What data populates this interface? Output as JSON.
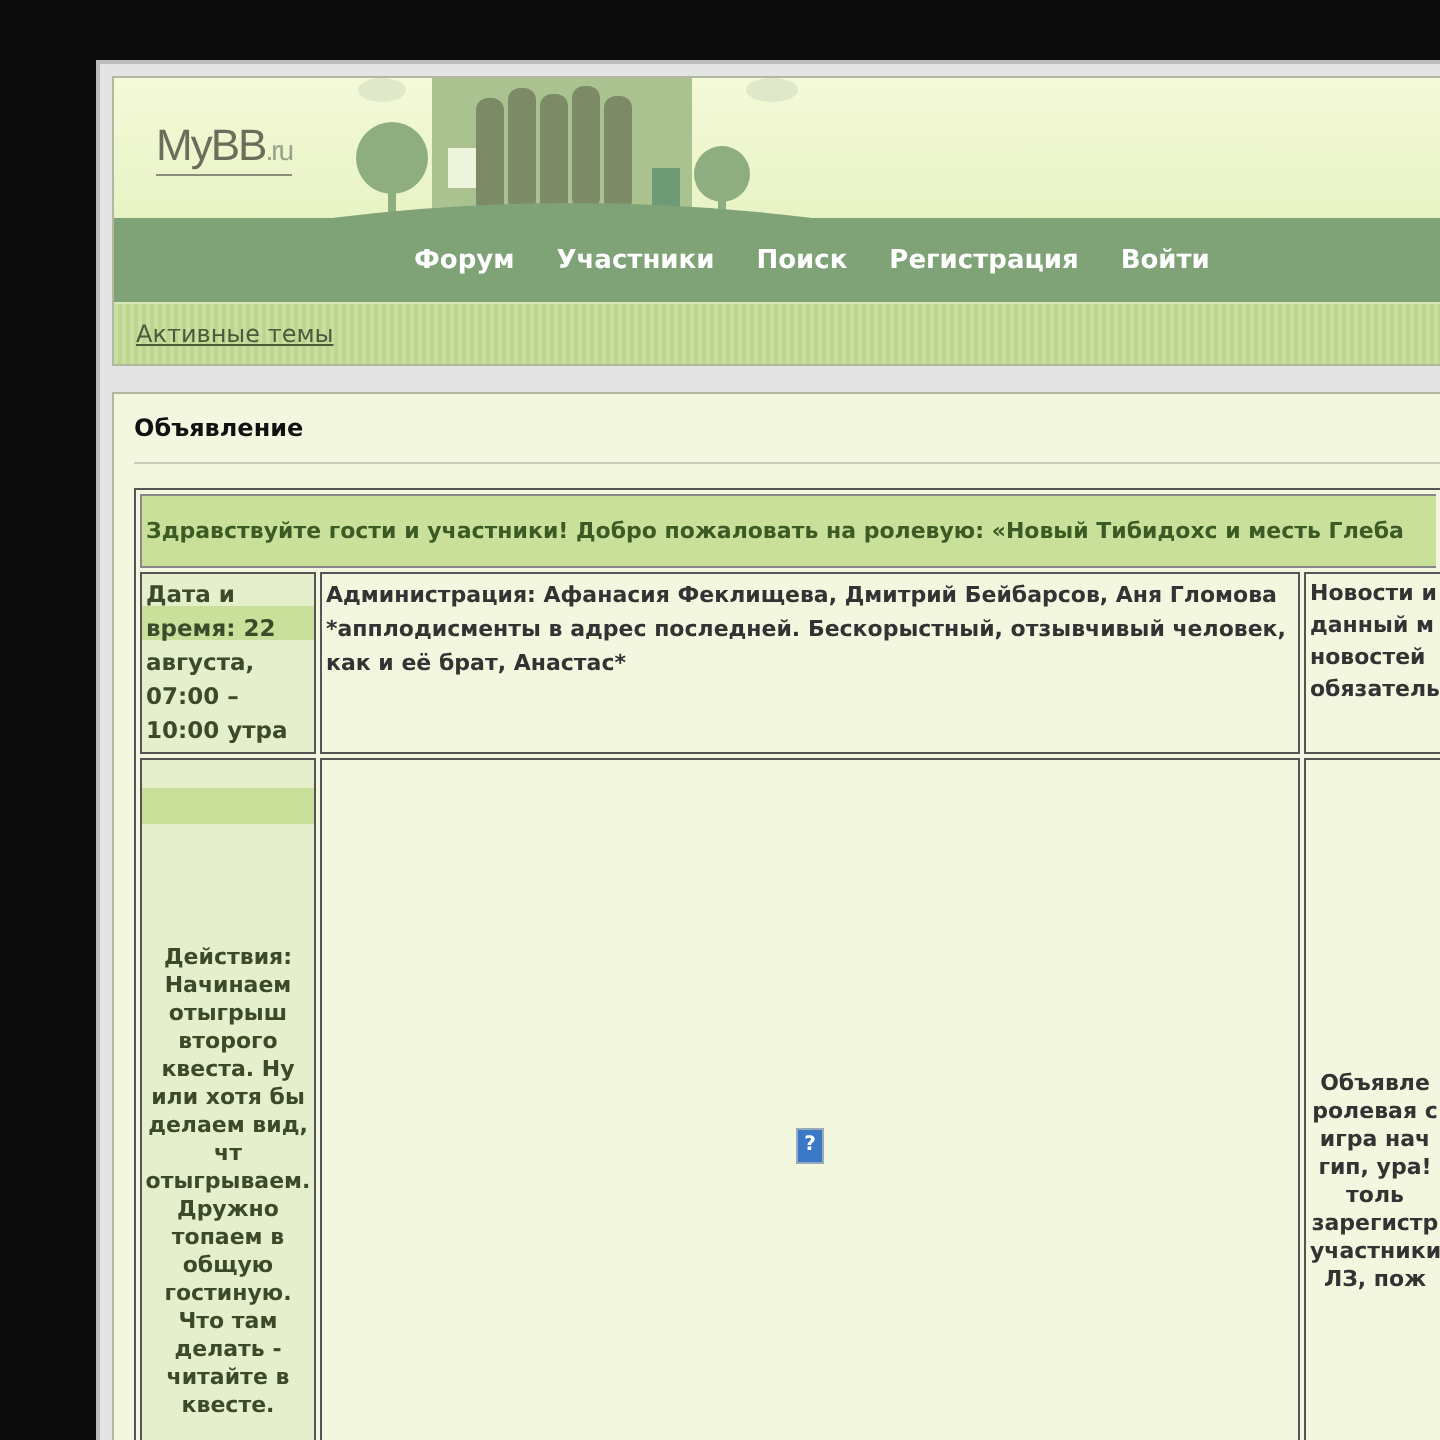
{
  "logo": {
    "main": "MyBB",
    "suffix": ".ru"
  },
  "nav": [
    {
      "label": "Форум"
    },
    {
      "label": "Участники"
    },
    {
      "label": "Поиск"
    },
    {
      "label": "Регистрация"
    },
    {
      "label": "Войти"
    }
  ],
  "subnav": {
    "link": "Активные темы"
  },
  "announcement": {
    "title": "Объявление",
    "banner": "Здравствуйте гости и участники! Добро пожаловать на ролевую: «Новый Тибидохс и месть Глеба",
    "date": "Дата и\nвремя: 22\nавгуста,\n07:00 –\n10:00 утра",
    "admins": "Администрация: Афанасия Феклищева, Дмитрий Бейбарсов, Аня Гломова *апплодисменты в адрес последней. Бескорыстный, отзывчивый человек, как и её брат, Анастас*",
    "news": "Новости и\nданный м\nновостей\nобязатель",
    "actions": "Действия:\nНачинаем\nотыгрыш\nвторого\nквеста. Ну\nили хотя бы\nделаем вид,\nчт\nотыгрываем.\nДружно\nтопаем в\nобщую\nгостиную.\nЧто там\nделать -\nчитайте в\nквесте.",
    "broken_image": "?",
    "notice": "Объявле\nролевая с\nигра нач\nгип, ура!\nтоль\nзарегистр\nучастники\nЛЗ, пож"
  }
}
